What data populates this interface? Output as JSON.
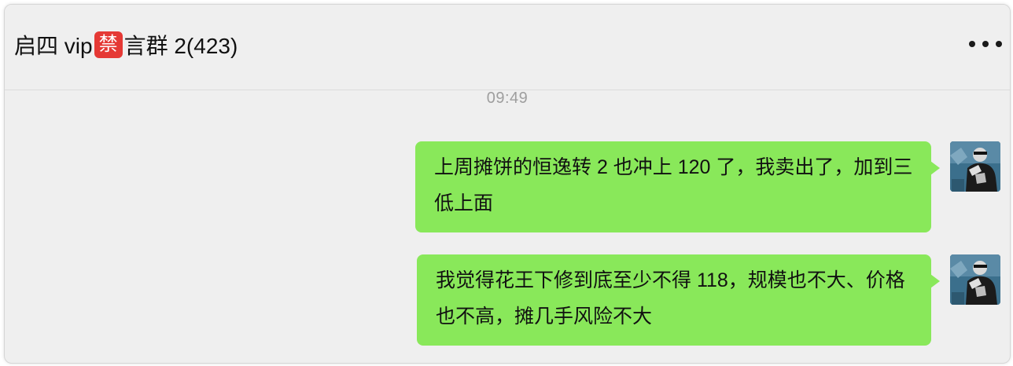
{
  "chat": {
    "title_prefix": "启四 vip",
    "ban_emoji": "禁",
    "title_suffix": "言群 2(423)",
    "more_icon": "more-horizontal-icon"
  },
  "timestamp": "09:49",
  "messages": [
    {
      "sender": "self",
      "text": "上周摊饼的恒逸转 2 也冲上 120 了，我卖出了，加到三低上面",
      "avatar_icon": "user-avatar-image"
    },
    {
      "sender": "self",
      "text": "我觉得花王下修到底至少不得 118，规模也不大、价格也不高，摊几手风险不大",
      "avatar_icon": "user-avatar-image"
    }
  ],
  "colors": {
    "bubble": "#89e85a",
    "ban_badge": "#e53935",
    "window_bg": "#efefef",
    "timestamp": "#9e9e9e"
  }
}
